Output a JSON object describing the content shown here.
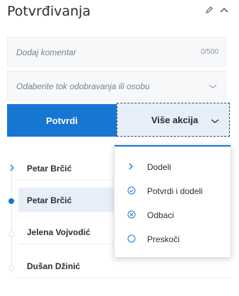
{
  "header": {
    "title": "Potvrđivanja",
    "edit_icon": "pencil-icon",
    "collapse_icon": "chevron-up-icon"
  },
  "comment": {
    "placeholder": "Dodaj komentar",
    "counter": "0/500"
  },
  "approval_select": {
    "placeholder": "Odaberite tok odobravanja ili osobu"
  },
  "actions": {
    "confirm_label": "Potvrdi",
    "more_label": "Više akcija"
  },
  "dropdown": {
    "items": [
      {
        "label": "Dodeli",
        "icon": "chevron-right-icon"
      },
      {
        "label": "Potvrdi i dodeli",
        "icon": "check-circle-icon"
      },
      {
        "label": "Odbaci",
        "icon": "x-circle-icon"
      },
      {
        "label": "Preskoči",
        "icon": "circle-icon"
      }
    ]
  },
  "approvers": [
    {
      "name": "Petar Brčić",
      "state": "next"
    },
    {
      "name": "Petar Brčić",
      "state": "current"
    },
    {
      "name": "Jelena Vojvodić",
      "state": "pending"
    },
    {
      "name": "Dušan Džinić",
      "state": "pending"
    }
  ],
  "colors": {
    "primary": "#1677d2",
    "active_row": "#e7eef8",
    "field_bg": "#f7f8f9"
  }
}
